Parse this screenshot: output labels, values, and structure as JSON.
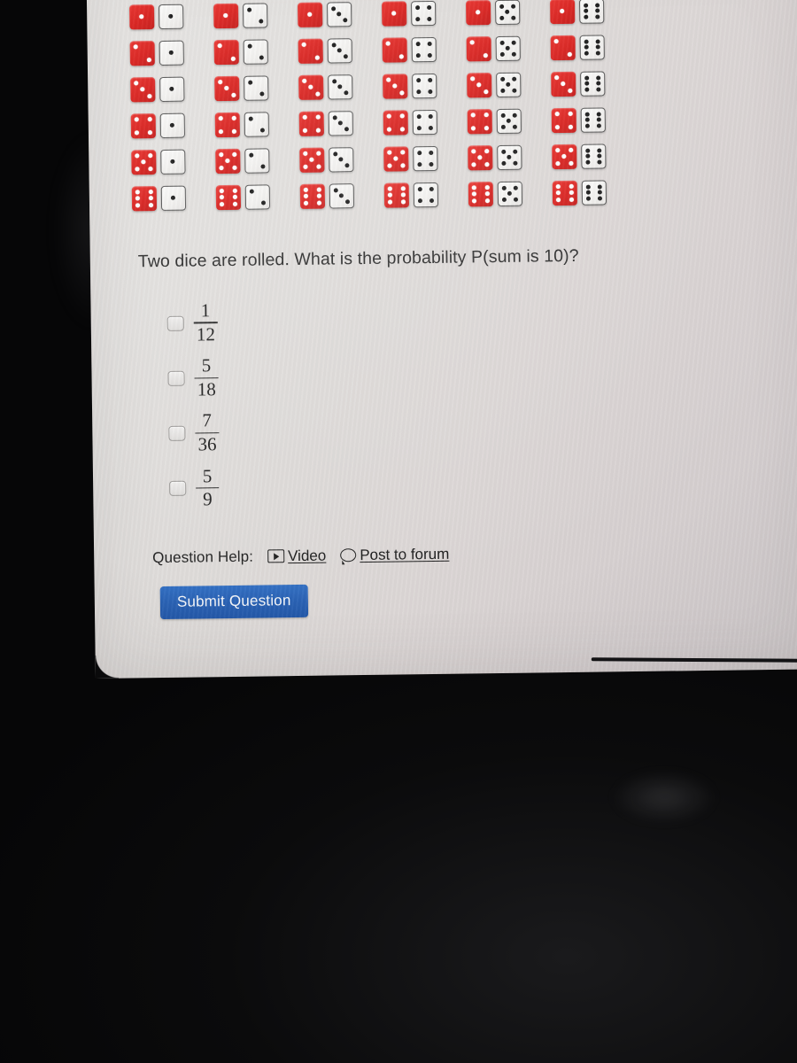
{
  "question": {
    "text": "Two dice are rolled. What is the probability P(sum is 10)?"
  },
  "dice_grid": {
    "rows": 6,
    "columns": 6,
    "red_die_color": "#d9201d",
    "white_die_color": "#f2f1ef",
    "pairs": [
      [
        [
          1,
          1
        ],
        [
          1,
          2
        ],
        [
          1,
          3
        ],
        [
          1,
          4
        ],
        [
          1,
          5
        ],
        [
          1,
          6
        ]
      ],
      [
        [
          2,
          1
        ],
        [
          2,
          2
        ],
        [
          2,
          3
        ],
        [
          2,
          4
        ],
        [
          2,
          5
        ],
        [
          2,
          6
        ]
      ],
      [
        [
          3,
          1
        ],
        [
          3,
          2
        ],
        [
          3,
          3
        ],
        [
          3,
          4
        ],
        [
          3,
          5
        ],
        [
          3,
          6
        ]
      ],
      [
        [
          4,
          1
        ],
        [
          4,
          2
        ],
        [
          4,
          3
        ],
        [
          4,
          4
        ],
        [
          4,
          5
        ],
        [
          4,
          6
        ]
      ],
      [
        [
          5,
          1
        ],
        [
          5,
          2
        ],
        [
          5,
          3
        ],
        [
          5,
          4
        ],
        [
          5,
          5
        ],
        [
          5,
          6
        ]
      ],
      [
        [
          6,
          1
        ],
        [
          6,
          2
        ],
        [
          6,
          3
        ],
        [
          6,
          4
        ],
        [
          6,
          5
        ],
        [
          6,
          6
        ]
      ]
    ]
  },
  "choices": [
    {
      "numerator": "1",
      "denominator": "12",
      "checked": false
    },
    {
      "numerator": "5",
      "denominator": "18",
      "checked": false
    },
    {
      "numerator": "7",
      "denominator": "36",
      "checked": false
    },
    {
      "numerator": "5",
      "denominator": "9",
      "checked": false
    }
  ],
  "help": {
    "label": "Question Help:",
    "video_label": "Video",
    "video_icon": "play-video-icon",
    "forum_label": "Post to forum",
    "forum_icon": "speech-bubble-icon"
  },
  "submit": {
    "label": "Submit Question",
    "color": "#2a62b4"
  }
}
